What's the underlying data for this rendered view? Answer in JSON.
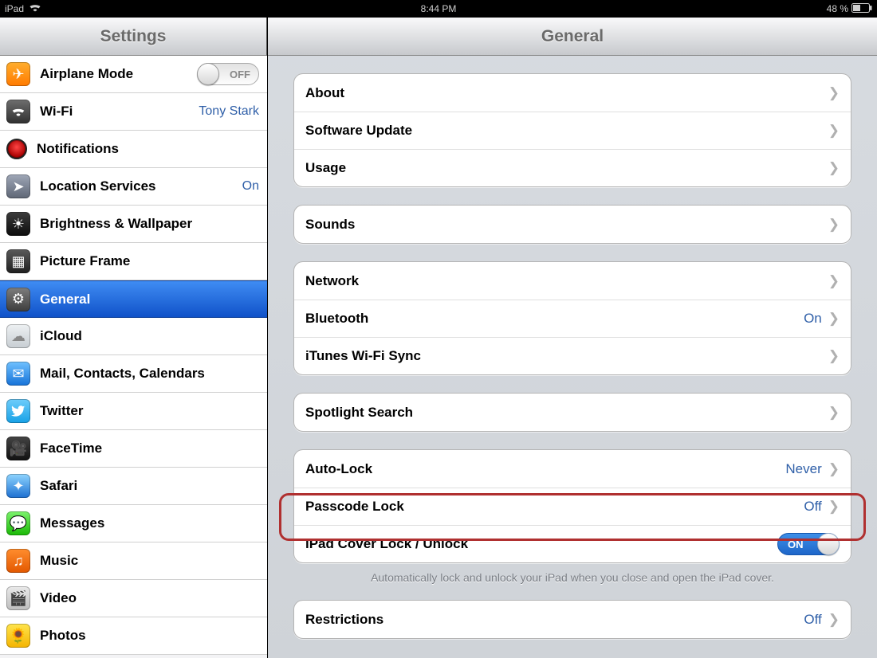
{
  "status": {
    "device": "iPad",
    "time": "8:44 PM",
    "battery_pct": "48 %"
  },
  "sidebar": {
    "title": "Settings",
    "items": [
      {
        "label": "Airplane Mode",
        "value": "",
        "toggle": "OFF"
      },
      {
        "label": "Wi-Fi",
        "value": "Tony Stark"
      },
      {
        "label": "Notifications",
        "value": ""
      },
      {
        "label": "Location Services",
        "value": "On"
      },
      {
        "label": "Brightness & Wallpaper",
        "value": ""
      },
      {
        "label": "Picture Frame",
        "value": ""
      },
      {
        "label": "General",
        "value": ""
      },
      {
        "label": "iCloud",
        "value": ""
      },
      {
        "label": "Mail, Contacts, Calendars",
        "value": ""
      },
      {
        "label": "Twitter",
        "value": ""
      },
      {
        "label": "FaceTime",
        "value": ""
      },
      {
        "label": "Safari",
        "value": ""
      },
      {
        "label": "Messages",
        "value": ""
      },
      {
        "label": "Music",
        "value": ""
      },
      {
        "label": "Video",
        "value": ""
      },
      {
        "label": "Photos",
        "value": ""
      }
    ]
  },
  "detail": {
    "title": "General",
    "groups": {
      "g0": [
        {
          "label": "About"
        },
        {
          "label": "Software Update"
        },
        {
          "label": "Usage"
        }
      ],
      "g1": [
        {
          "label": "Sounds"
        }
      ],
      "g2": [
        {
          "label": "Network"
        },
        {
          "label": "Bluetooth",
          "value": "On"
        },
        {
          "label": "iTunes Wi-Fi Sync"
        }
      ],
      "g3": [
        {
          "label": "Spotlight Search"
        }
      ],
      "g4": [
        {
          "label": "Auto-Lock",
          "value": "Never"
        },
        {
          "label": "Passcode Lock",
          "value": "Off"
        },
        {
          "label": "iPad Cover Lock / Unlock",
          "toggle": "ON"
        }
      ],
      "g4_note": "Automatically lock and unlock your iPad when you close and open the iPad cover.",
      "g5": [
        {
          "label": "Restrictions",
          "value": "Off"
        }
      ]
    }
  }
}
